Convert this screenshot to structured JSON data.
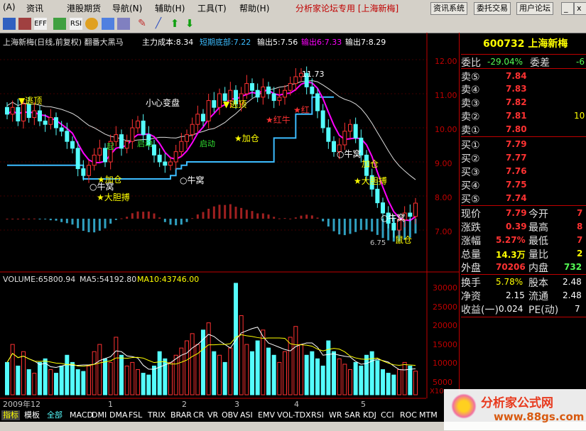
{
  "menu": {
    "items": [
      "(A)",
      "资讯",
      "港股期货",
      "导航(N)",
      "辅助(H)",
      "工具(T)",
      "帮助(H)"
    ],
    "forum_label": "分析家论坛专用 [上海新梅]",
    "buttons": [
      "资讯系统",
      "委托交易",
      "用户论坛"
    ]
  },
  "toolbar": {
    "icons": [
      "grid-icon",
      "chart-icon",
      "eff-icon",
      "vol-icon",
      "rsi-icon",
      "pie-icon",
      "swap-icon",
      "window-icon",
      "pencil-icon",
      "line-icon",
      "arrow-up-icon",
      "arrow-down-icon"
    ],
    "labels": [
      "",
      "",
      "EFF",
      "",
      "RSI",
      "",
      "",
      "",
      "",
      "",
      "",
      ""
    ]
  },
  "header": {
    "title": "上海新梅(日线,前复权) 翻番大黑马",
    "cost": "主力成本:8.34",
    "short_bottom": "短期底部:7.22",
    "out5": "输出5:7.56",
    "out6": "输出6:7.33",
    "out7": "输出7:8.29"
  },
  "price_axis": [
    "12.00",
    "11.00",
    "10.00",
    "9.00",
    "8.00",
    "7.00"
  ],
  "volume_header": {
    "label": "VOLUME:65800.94",
    "ma5": "MA5:54192.80",
    "ma10": "MA10:43746.00"
  },
  "volume_axis": [
    "30000",
    "25000",
    "20000",
    "15000",
    "10000",
    "5000"
  ],
  "volume_unit": "X10",
  "time_axis": [
    "2009年12",
    "1",
    "2",
    "3",
    "4",
    "5"
  ],
  "signals": {
    "escape_top": "▼逃顶",
    "caution": "小心变盘",
    "add_position": "★加仓",
    "bull_nest": "○牛窝",
    "bold_catch": "★大胆搏",
    "red_cow": "★红牛",
    "red_cow2": "★红",
    "start_up": "启动",
    "breakout_1": "起",
    "breakout_2": "启动",
    "high_label": "11.73",
    "low_label": "6.75",
    "add_pos_right": "加仓",
    "bear_out": "鼠仓"
  },
  "quote": {
    "code_name": "600732 上海新梅",
    "weibi_label": "委比",
    "weibi": "-29.04%",
    "weicha_label": "委差",
    "weicha": "-6",
    "sells": [
      {
        "label": "卖⑤",
        "price": "7.84"
      },
      {
        "label": "卖④",
        "price": "7.83"
      },
      {
        "label": "卖③",
        "price": "7.82"
      },
      {
        "label": "卖②",
        "price": "7.81",
        "vol": "10"
      },
      {
        "label": "卖①",
        "price": "7.80"
      }
    ],
    "buys": [
      {
        "label": "买①",
        "price": "7.79"
      },
      {
        "label": "买②",
        "price": "7.77"
      },
      {
        "label": "买③",
        "price": "7.76"
      },
      {
        "label": "买④",
        "price": "7.75"
      },
      {
        "label": "买⑤",
        "price": "7.74"
      }
    ],
    "stats": [
      {
        "label": "现价",
        "value": "7.79",
        "label2": "今开",
        "value2": "7"
      },
      {
        "label": "涨跌",
        "value": "0.39",
        "label2": "最高",
        "value2": "8"
      },
      {
        "label": "涨幅",
        "value": "5.27%",
        "label2": "最低",
        "value2": "7"
      },
      {
        "label": "总量",
        "value": "14.3万",
        "label2": "量比",
        "value2": "2"
      },
      {
        "label": "外盘",
        "value": "70206",
        "label2": "内盘",
        "value2": "732"
      }
    ],
    "stats2": [
      {
        "label": "换手",
        "value": "5.78%",
        "label2": "股本",
        "value2": "2.48"
      },
      {
        "label": "净资",
        "value": "2.15",
        "label2": "流通",
        "value2": "2.48"
      },
      {
        "label": "收益(一)",
        "value": "0.024",
        "label2": "PE(动)",
        "value2": "7"
      }
    ]
  },
  "bottom_tabs": [
    "指标",
    "模板",
    "全部",
    "MACD",
    "DMI",
    "DMA",
    "FSL",
    "TRIX",
    "BRAR",
    "CR",
    "VR",
    "OBV",
    "ASI",
    "EMV",
    "VOL-TDX",
    "RSI",
    "WR",
    "SAR",
    "KDJ",
    "CCI",
    "ROC",
    "MTM"
  ],
  "watermark": {
    "text": "分析家公式网",
    "url": "www.88gs.com"
  },
  "colors": {
    "up": "#ff3232",
    "down": "#54fcfc",
    "ma_white": "#dcdcdc",
    "ma_magenta": "#ff00ff",
    "ma_yellow": "#ffff00",
    "cyan_line": "#3cbcff",
    "axis": "#c00000"
  },
  "chart_data": {
    "type": "candlestick",
    "ylim": [
      6.5,
      12.3
    ],
    "closes": [
      10.4,
      10.6,
      10.2,
      10.7,
      10.3,
      10.5,
      10.2,
      10.1,
      10.3,
      10.0,
      9.9,
      9.6,
      9.4,
      8.8,
      8.6,
      8.9,
      9.2,
      9.4,
      9.0,
      9.6,
      9.8,
      9.4,
      9.6,
      10.0,
      10.2,
      9.8,
      9.5,
      9.2,
      9.0,
      8.9,
      9.0,
      9.3,
      9.6,
      9.8,
      10.1,
      10.4,
      10.2,
      10.8,
      10.6,
      11.0,
      10.8,
      11.1,
      10.7,
      11.0,
      11.3,
      11.1,
      10.9,
      11.2,
      11.0,
      10.8,
      10.9,
      11.1,
      11.3,
      11.5,
      11.6,
      11.2,
      11.0,
      10.5,
      10.0,
      9.6,
      9.3,
      9.5,
      9.9,
      10.1,
      9.7,
      9.2,
      8.6,
      8.2,
      7.8,
      7.5,
      7.2,
      7.0,
      7.3,
      7.5,
      7.4,
      7.79
    ],
    "volume_ylim": [
      0,
      32000
    ],
    "volume": [
      9000,
      14000,
      8000,
      12000,
      7000,
      6000,
      9000,
      10000,
      7000,
      6000,
      8000,
      11000,
      9000,
      7000,
      6500,
      8000,
      12000,
      14000,
      10000,
      9000,
      16000,
      11000,
      8000,
      9000,
      7000,
      6000,
      5500,
      8000,
      12000,
      10000,
      9000,
      11000,
      13000,
      15000,
      17000,
      14000,
      18000,
      20000,
      12000,
      11000,
      9000,
      13000,
      31000,
      22000,
      14000,
      12000,
      15000,
      18000,
      13000,
      11000,
      9000,
      12000,
      16000,
      19000,
      14000,
      11000,
      12000,
      10000,
      8000,
      15000,
      12000,
      10000,
      8500,
      7000,
      9000,
      8000,
      11000,
      12000,
      9500,
      7000,
      6000,
      5500,
      7000,
      9000,
      8000,
      6580
    ]
  }
}
